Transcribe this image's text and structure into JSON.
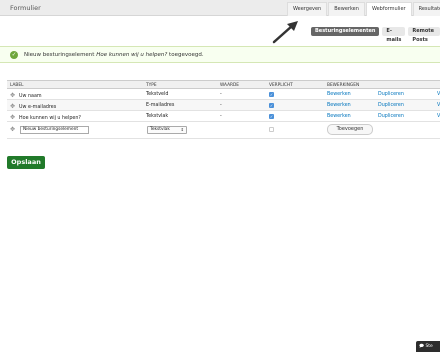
{
  "header": {
    "title": "Formulier",
    "tabs": [
      "Weergeven",
      "Bewerken",
      "Webformulier",
      "Resultaten"
    ]
  },
  "subtabs": [
    "Besturingselementen",
    "E-mails",
    "Remote Posts"
  ],
  "message": {
    "prefix": "Nieuw besturingselement ",
    "emphasis": "Hoe kunnen wij u helpen?",
    "suffix": " toegevoegd."
  },
  "table": {
    "headers": [
      "LABEL",
      "TYPE",
      "WAARDE",
      "VERPLICHT",
      "BEWERKINGEN"
    ],
    "rows": [
      {
        "label": "Uw naam",
        "type": "Tekstveld",
        "value": "-",
        "required": true,
        "op_edit": "Bewerken",
        "op_dup": "Dupliceren",
        "op_more": "V"
      },
      {
        "label": "Uw e-mailadres",
        "type": "E-mailadres",
        "value": "-",
        "required": true,
        "op_edit": "Bewerken",
        "op_dup": "Dupliceren",
        "op_more": "V"
      },
      {
        "label": "Hoe kunnen wij u helpen?",
        "type": "Tekstvlak",
        "value": "-",
        "required": true,
        "op_edit": "Bewerken",
        "op_dup": "Dupliceren",
        "op_more": "V"
      }
    ],
    "new_row": {
      "label_value": "Nieuw besturingselement",
      "type_value": "Tekstvlak",
      "add_label": "Toevoegen"
    }
  },
  "save_label": "Opslaan",
  "corner_label": "Ste",
  "icons": {
    "drag": "drag-handle-icon",
    "check": "check-circle-icon",
    "arrow": "pointer-arrow-icon",
    "chat": "chat-icon"
  },
  "colors": {
    "save_button": "#217a2a",
    "link": "#0074bd",
    "checkbox": "#4a90d9",
    "message_bg": "#f8fff0",
    "active_subtab": "#666666"
  }
}
